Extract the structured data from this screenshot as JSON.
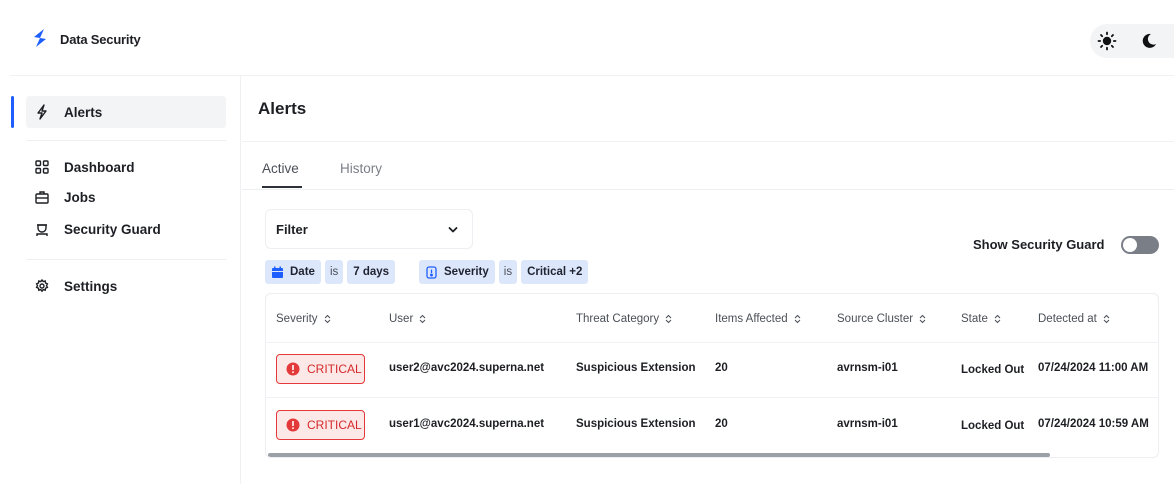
{
  "app": {
    "title": "Data Security"
  },
  "sidebar": {
    "items": [
      {
        "label": "Alerts",
        "icon": "bolt-icon"
      },
      {
        "label": "Dashboard",
        "icon": "grid-icon"
      },
      {
        "label": "Jobs",
        "icon": "briefcase-icon"
      },
      {
        "label": "Security Guard",
        "icon": "guard-icon"
      },
      {
        "label": "Settings",
        "icon": "gear-icon"
      }
    ]
  },
  "page": {
    "title": "Alerts"
  },
  "tabs": [
    {
      "label": "Active"
    },
    {
      "label": "History"
    }
  ],
  "filter": {
    "label": "Filter",
    "chips": [
      {
        "field": "Date",
        "op": "is",
        "value": "7 days"
      },
      {
        "field": "Severity",
        "op": "is",
        "value": "Critical +2"
      }
    ]
  },
  "security_guard": {
    "label": "Show Security Guard",
    "enabled": false
  },
  "table": {
    "columns": [
      "Severity",
      "User",
      "Threat Category",
      "Items Affected",
      "Source Cluster",
      "State",
      "Detected at"
    ],
    "rows": [
      {
        "severity": "CRITICAL",
        "user": "user2@avc2024.superna.net",
        "threat": "Suspicious Extension",
        "items": "20",
        "cluster": "avrnsm-i01",
        "state": "Locked Out",
        "detected": "07/24/2024 11:00 AM"
      },
      {
        "severity": "CRITICAL",
        "user": "user1@avc2024.superna.net",
        "threat": "Suspicious Extension",
        "items": "20",
        "cluster": "avrnsm-i01",
        "state": "Locked Out",
        "detected": "07/24/2024 10:59 AM"
      }
    ]
  },
  "colors": {
    "accent": "#1e5eff",
    "critical": "#e4393b",
    "chip": "#dde7fb"
  }
}
